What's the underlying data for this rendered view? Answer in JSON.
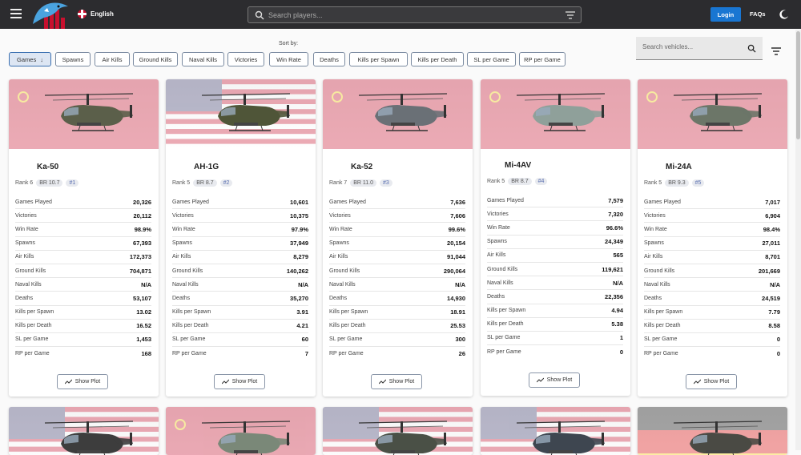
{
  "header": {
    "language": "English",
    "search_placeholder": "Search players...",
    "login_label": "Login",
    "faqs_label": "FAQs"
  },
  "sort": {
    "label": "Sort by:",
    "options": [
      "Games",
      "Spawns",
      "Air Kills",
      "Ground Kills",
      "Naval Kills",
      "Victories",
      "Win Rate",
      "Deaths",
      "Kills per Spawn",
      "Kills per Death",
      "SL per Game",
      "RP per Game"
    ],
    "active": "Games"
  },
  "vehicle_search": {
    "placeholder": "Search vehicles..."
  },
  "colors": {
    "accent": "#1976d2",
    "topbar": "#2c2c2f"
  },
  "stat_labels": [
    "Games Played",
    "Victories",
    "Win Rate",
    "Spawns",
    "Air Kills",
    "Ground Kills",
    "Naval Kills",
    "Deaths",
    "Kills per Spawn",
    "Kills per Death",
    "SL per Game",
    "RP per Game"
  ],
  "plot_label": "Show Plot",
  "cards": [
    {
      "name": "Ka-50",
      "rank": "Rank 6",
      "br": "BR 10.7",
      "pos": "#1",
      "flag": "ussr",
      "stats": [
        "20,326",
        "20,112",
        "98.9%",
        "67,393",
        "172,373",
        "704,871",
        "N/A",
        "53,107",
        "13.02",
        "16.52",
        "1,453",
        "168"
      ]
    },
    {
      "name": "AH-1G",
      "rank": "Rank 5",
      "br": "BR 8.7",
      "pos": "#2",
      "flag": "usa",
      "stats": [
        "10,601",
        "10,375",
        "97.9%",
        "37,949",
        "8,279",
        "140,262",
        "N/A",
        "35,270",
        "3.91",
        "4.21",
        "60",
        "7"
      ]
    },
    {
      "name": "Ka-52",
      "rank": "Rank 7",
      "br": "BR 11.0",
      "pos": "#3",
      "flag": "ussr",
      "stats": [
        "7,636",
        "7,606",
        "99.6%",
        "20,154",
        "91,044",
        "290,064",
        "N/A",
        "14,930",
        "18.91",
        "25.53",
        "300",
        "26"
      ]
    },
    {
      "name": "Mi-4AV",
      "rank": "Rank 5",
      "br": "BR 8.7",
      "pos": "#4",
      "flag": "ussr",
      "stats": [
        "7,579",
        "7,320",
        "96.6%",
        "24,349",
        "565",
        "119,621",
        "N/A",
        "22,356",
        "4.94",
        "5.38",
        "1",
        "0"
      ]
    },
    {
      "name": "Mi-24A",
      "rank": "Rank 5",
      "br": "BR 9.3",
      "pos": "#5",
      "flag": "ussr",
      "stats": [
        "7,017",
        "6,904",
        "98.4%",
        "27,011",
        "8,701",
        "201,669",
        "N/A",
        "24,519",
        "7.79",
        "8.58",
        "0",
        "0"
      ]
    }
  ]
}
